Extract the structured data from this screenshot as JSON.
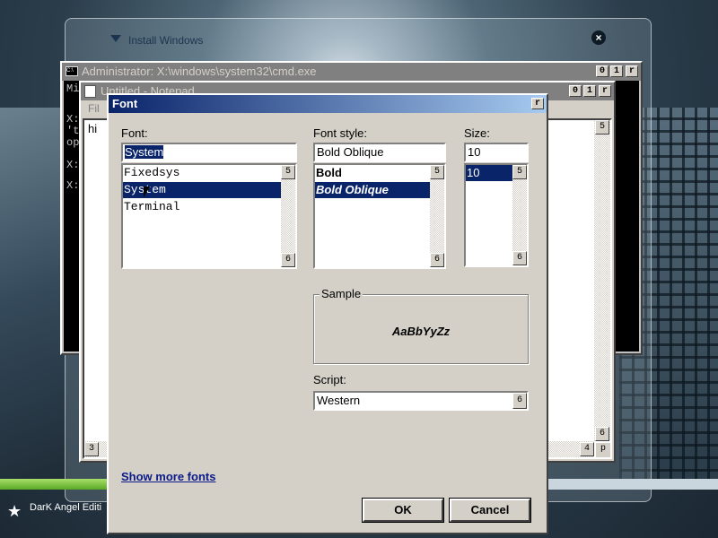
{
  "install_window": {
    "title": "Install Windows"
  },
  "cmd_window": {
    "title": "Administrator: X:\\windows\\system32\\cmd.exe",
    "icon_label": "C:\\",
    "lines": [
      "Mi",
      "X:",
      "'t",
      "op",
      "X:",
      "X:"
    ]
  },
  "notepad": {
    "title": "Untitled - Notepad",
    "menu_first": "Fil",
    "text": "hi"
  },
  "titlebar_buttons": {
    "minimize": "0",
    "maximize": "1",
    "close": "r"
  },
  "scroll_glyphs": {
    "up": "5",
    "down": "6",
    "left": "3",
    "right": "4",
    "grip": "p"
  },
  "font_dialog": {
    "title": "Font",
    "close": "r",
    "font": {
      "label": "Font:",
      "value": "System",
      "items": [
        "Fixedsys",
        "System",
        "Terminal"
      ],
      "selected_index": 1
    },
    "style": {
      "label": "Font style:",
      "value": "Bold Oblique",
      "items": [
        "Bold",
        "Bold Oblique"
      ],
      "selected_index": 1
    },
    "size": {
      "label": "Size:",
      "value": "10",
      "items": [
        "10"
      ],
      "selected_index": 0
    },
    "sample": {
      "label": "Sample",
      "text": "AaBbYyZz"
    },
    "script": {
      "label": "Script:",
      "value": "Western",
      "dropdown": "6"
    },
    "show_more_fonts": "Show more fonts",
    "ok": "OK",
    "cancel": "Cancel"
  },
  "taskbar": {
    "text": "DarK Angel Editi",
    "star": "★"
  },
  "progress": {
    "fraction": 0.74
  },
  "colors": {
    "title_active": "#0a246a",
    "selection": "#0a246a",
    "dialog_face": "#d4d0c8",
    "progress_green": "#5aa925"
  }
}
